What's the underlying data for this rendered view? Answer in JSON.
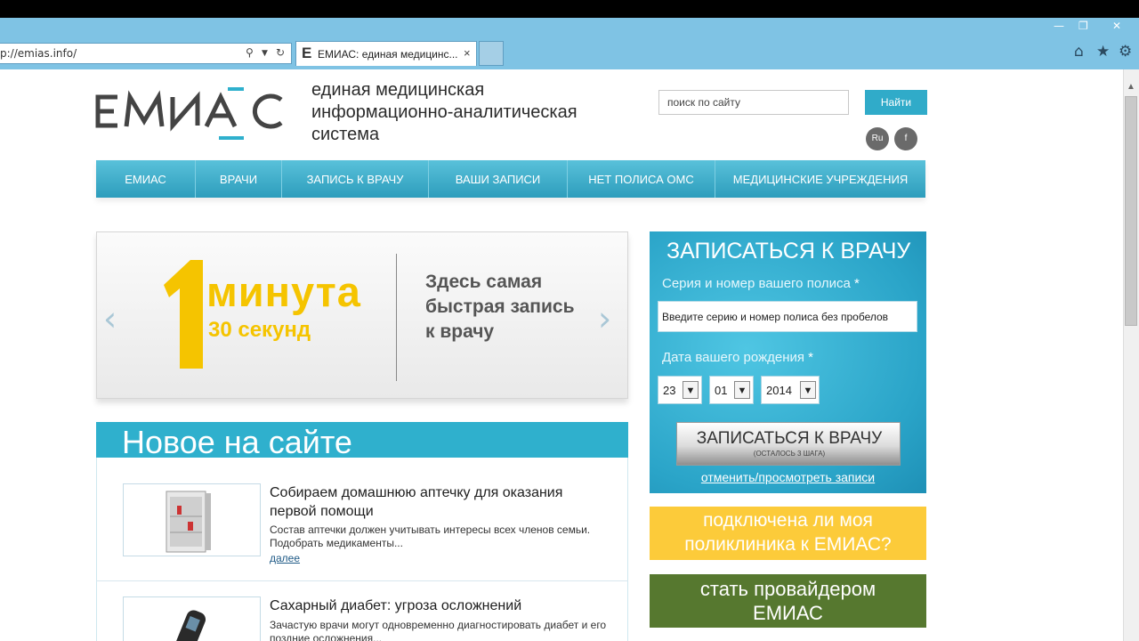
{
  "browser": {
    "url": "p://emias.info/",
    "tab_icon": "E",
    "tab_title": "ЕМИАС: единая медицинс...",
    "tab_close": "×",
    "win_minimize": "—",
    "win_restore": "❐",
    "win_close": "✕",
    "toolbar_icons": [
      "home-icon",
      "star-icon",
      "gear-icon"
    ]
  },
  "header": {
    "tagline": [
      "единая медицинская",
      "информационно-аналитическая",
      "система"
    ],
    "search_placeholder": "поиск по сайту",
    "search_button": "Найти",
    "lang_buttons": [
      "Ru",
      "f"
    ]
  },
  "nav": {
    "items": [
      "ЕМИАС",
      "ВРАЧИ",
      "ЗАПИСЬ К ВРАЧУ",
      "ВАШИ ЗАПИСИ",
      "НЕТ ПОЛИСА ОМС",
      "МЕДИЦИНСКИЕ УЧРЕЖДЕНИЯ"
    ]
  },
  "slider": {
    "big_number": "1",
    "headline": "минута",
    "subline": "30 секунд",
    "text": [
      "Здесь самая",
      "быстрая запись",
      "к врачу"
    ],
    "prev": "‹",
    "next": "›"
  },
  "news": {
    "title": "Новое на сайте",
    "items": [
      {
        "title": "Собираем домашнюю аптечку для оказания первой помощи",
        "text": "Состав аптечки должен учитывать интересы всех членов семьи. Подобрать медикаменты...",
        "more": "далее"
      },
      {
        "title": "Сахарный диабет: угроза осложнений",
        "text": "Зачастую врачи могут одновременно диагностировать диабет и его поздние осложнения..."
      }
    ]
  },
  "appointment": {
    "title": "ЗАПИСАТЬСЯ К ВРАЧУ",
    "policy_label": "Серия и номер вашего полиса",
    "policy_placeholder": "Введите серию и номер полиса без пробелов",
    "dob_label": "Дата вашего рождения",
    "required_mark": "*",
    "day": "23",
    "month": "01",
    "year": "2014",
    "select_arrow": "▼",
    "button": "ЗАПИСАТЬСЯ К ВРАЧУ",
    "button_sub": "(ОСТАЛОСЬ 3 ШАГА)",
    "link": "отменить/просмотреть записи"
  },
  "promos": {
    "yellow": [
      "подключена ли моя",
      "поликлиника к ЕМИАС?"
    ],
    "green": [
      "стать провайдером",
      "ЕМИАС"
    ]
  },
  "colors": {
    "accent": "#2fb0cd",
    "yellow": "#fccb3a",
    "green": "#56782f",
    "chrome": "#7fc3e4"
  }
}
